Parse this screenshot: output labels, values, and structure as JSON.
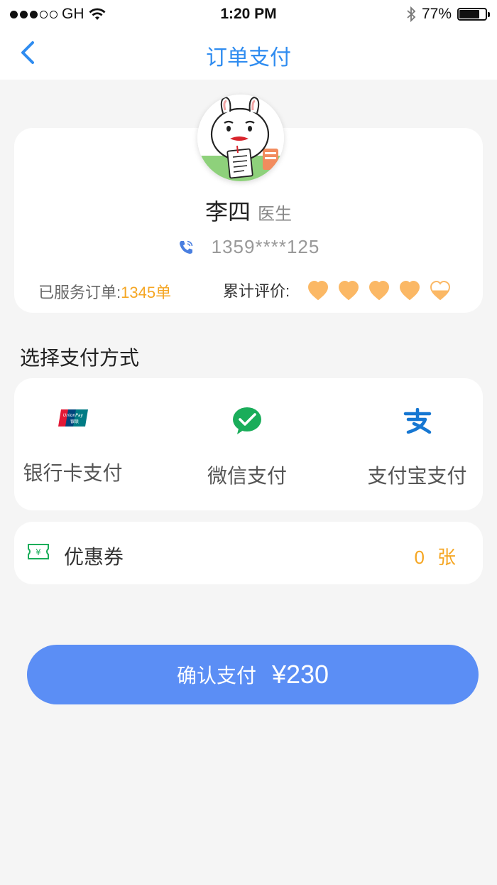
{
  "status_bar": {
    "carrier": "GH",
    "time": "1:20 PM",
    "battery": "77%",
    "battery_level": 0.77
  },
  "nav": {
    "back_icon": "chevron-left-icon",
    "title": "订单支付"
  },
  "doctor": {
    "name": "李四",
    "title": "医生",
    "phone": "1359****125",
    "orders_label": "已服务订单:",
    "orders_count": "1345单",
    "rating_label": "累计评价:",
    "rating_value": 4.5,
    "rating_max": 5
  },
  "payment": {
    "section_title": "选择支付方式",
    "options": [
      {
        "label": "银行卡支付",
        "icon": "unionpay-icon"
      },
      {
        "label": "微信支付",
        "icon": "wechat-icon"
      },
      {
        "label": "支付宝支付",
        "icon": "alipay-icon"
      }
    ]
  },
  "coupon": {
    "label": "优惠券",
    "count": "0",
    "unit": "张"
  },
  "confirm": {
    "label": "确认支付",
    "amount": "¥230"
  },
  "colors": {
    "accent_blue": "#2f8cf0",
    "button_blue": "#5b8ef5",
    "orange": "#f5a623",
    "heart": "#fbb865",
    "wechat_green": "#1aad5a",
    "alipay_blue": "#1677d2"
  }
}
